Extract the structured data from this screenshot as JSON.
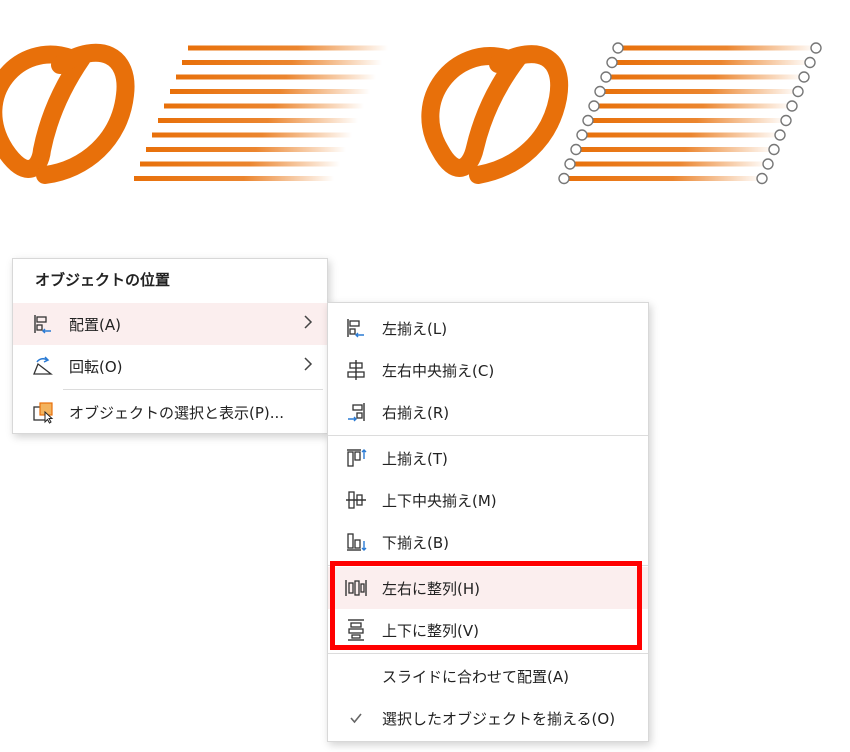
{
  "accent_orange": "#e8700a",
  "primary_menu": {
    "title": "オブジェクトの位置",
    "items": [
      {
        "label": "配置(A)",
        "icon": "align-left-icon",
        "has_submenu": true,
        "highlighted": true
      },
      {
        "label": "回転(O)",
        "icon": "rotate-icon",
        "has_submenu": true,
        "highlighted": false
      },
      {
        "label": "オブジェクトの選択と表示(P)...",
        "icon": "selection-pane-icon",
        "has_submenu": false,
        "highlighted": false
      }
    ]
  },
  "submenu": {
    "groups": [
      [
        {
          "label": "左揃え(L)",
          "icon": "align-left-icon"
        },
        {
          "label": "左右中央揃え(C)",
          "icon": "align-center-icon"
        },
        {
          "label": "右揃え(R)",
          "icon": "align-right-icon"
        }
      ],
      [
        {
          "label": "上揃え(T)",
          "icon": "align-top-icon"
        },
        {
          "label": "上下中央揃え(M)",
          "icon": "align-middle-icon"
        },
        {
          "label": "下揃え(B)",
          "icon": "align-bottom-icon"
        }
      ],
      [
        {
          "label": "左右に整列(H)",
          "icon": "distribute-horizontally-icon",
          "highlighted": true
        },
        {
          "label": "上下に整列(V)",
          "icon": "distribute-vertically-icon"
        }
      ],
      [
        {
          "label": "スライドに合わせて配置(A)",
          "icon": null
        },
        {
          "label": "選択したオブジェクトを揃える(O)",
          "icon": "checkmark-icon",
          "checked": true
        }
      ]
    ]
  },
  "highlight_box_color": "#ff0000"
}
